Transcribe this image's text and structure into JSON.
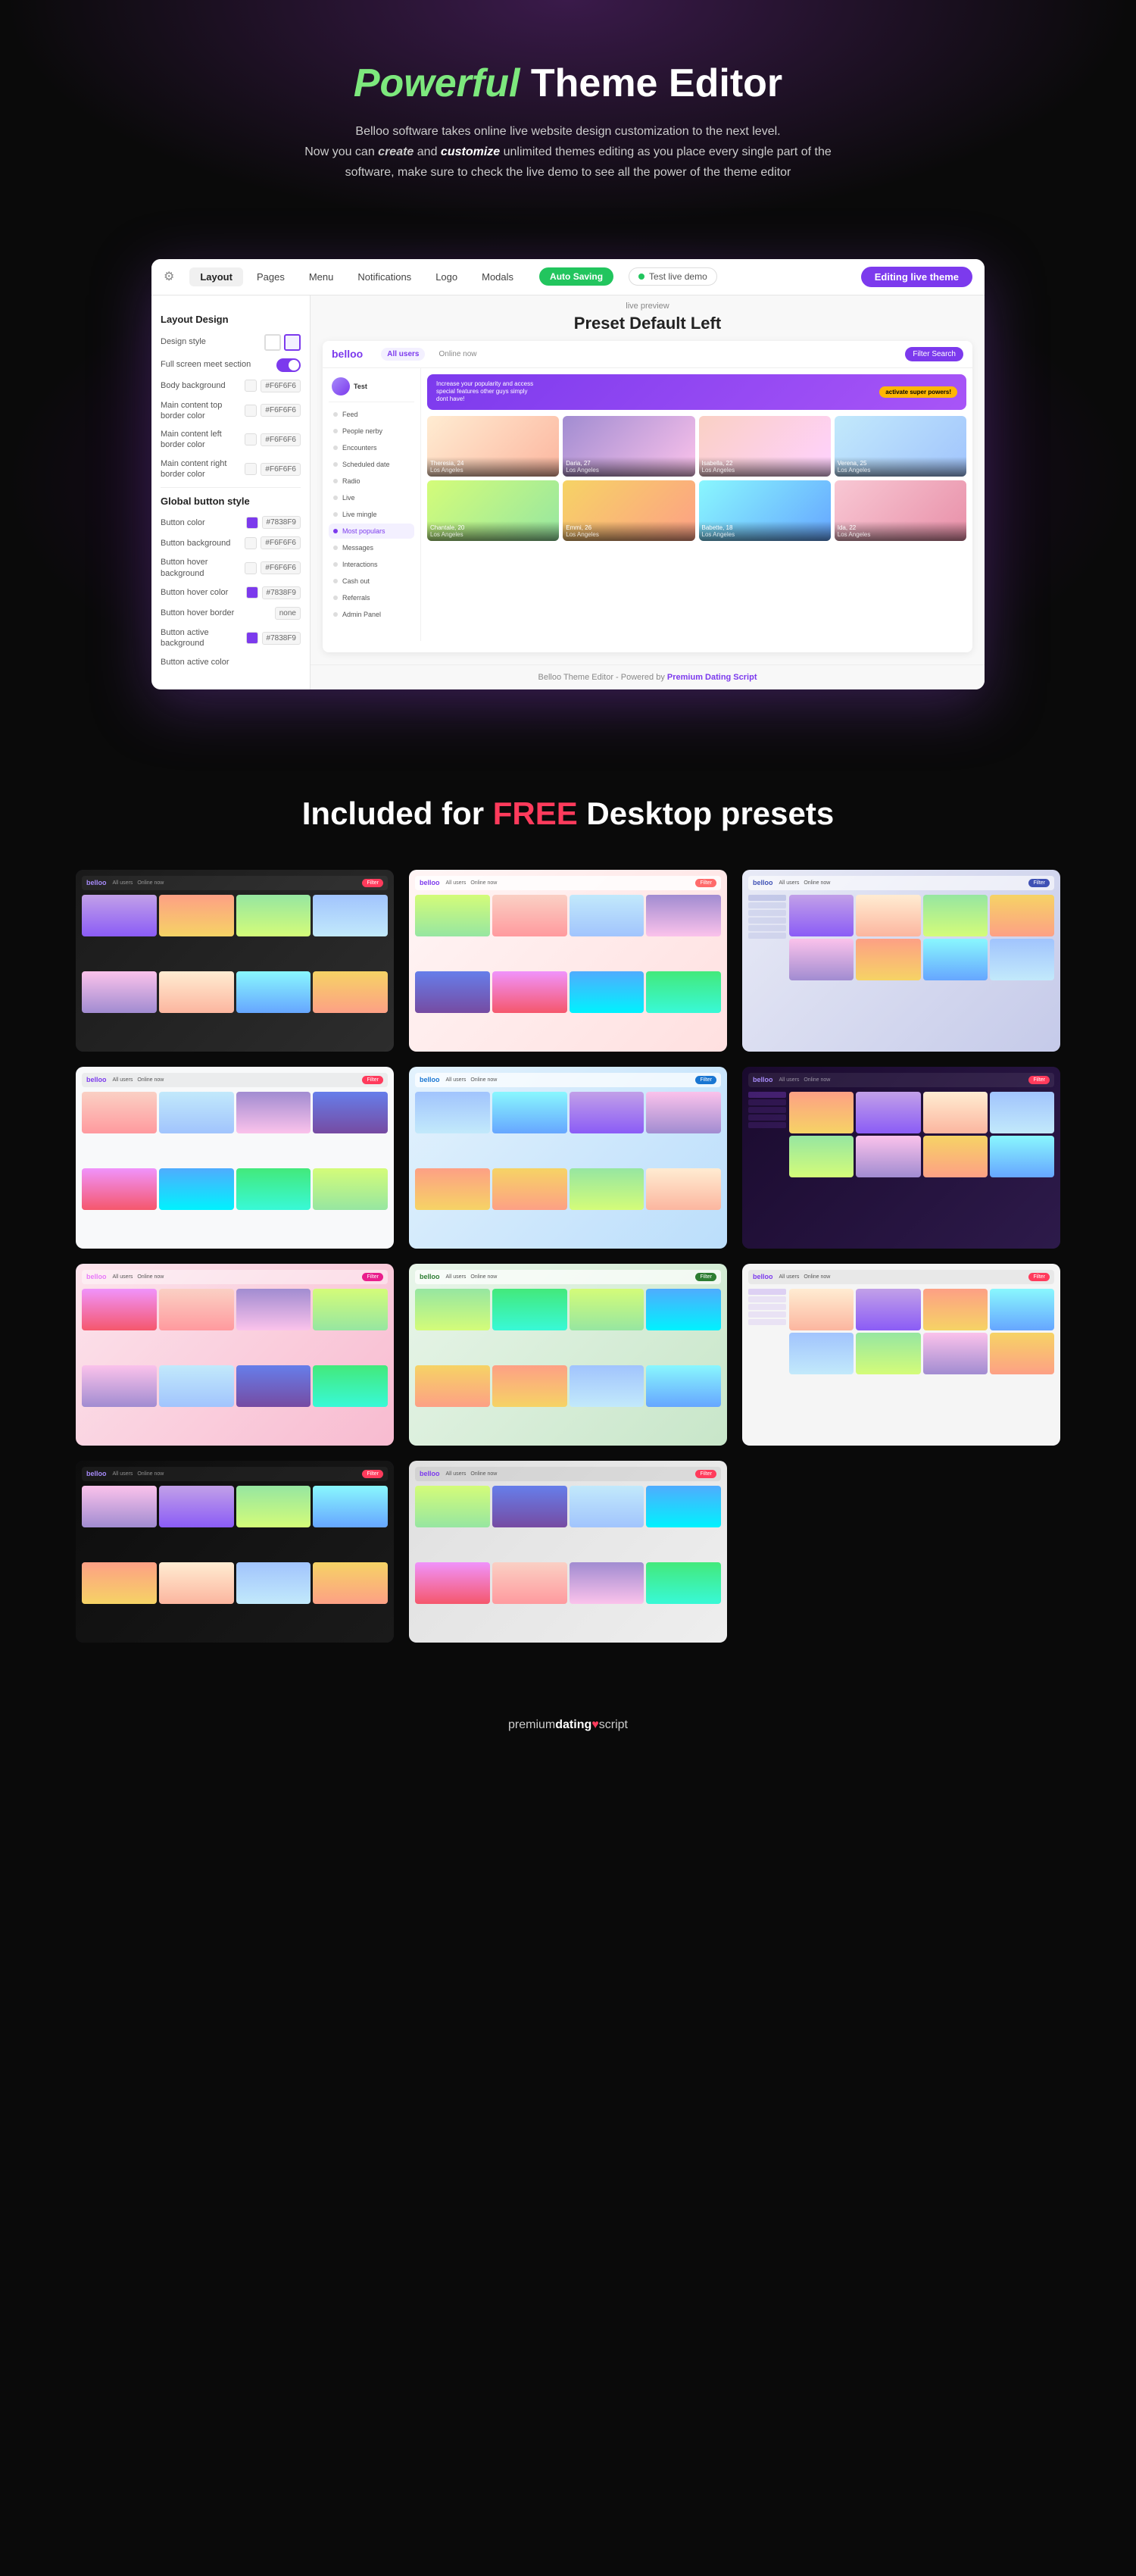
{
  "hero": {
    "title_powerful": "Powerful",
    "title_main": " Theme Editor",
    "subtitle_line1": "Belloo software takes online live website design customization to the next level.",
    "subtitle_line2_pre": "Now you can ",
    "subtitle_line2_create": "create",
    "subtitle_line2_mid": " and ",
    "subtitle_line2_customize": "customize",
    "subtitle_line2_post": " unlimited themes editing as you place every single part of the software, make sure to check the live demo to see all the power of the theme editor"
  },
  "editor": {
    "nav_items": [
      "Layout",
      "Pages",
      "Menu",
      "Notifications",
      "Logo",
      "Modals"
    ],
    "auto_saving_label": "Auto Saving",
    "test_live_label": "Test live demo",
    "editing_live_label": "Editing live theme",
    "preview_label": "live preview",
    "preview_title": "Preset Default Left",
    "left_panel": {
      "layout_design_title": "Layout Design",
      "design_style_label": "Design style",
      "full_section_label": "Full screen meet section",
      "body_bg_label": "Body background",
      "body_bg_value": "#F6F6F6",
      "main_top_label": "Main content top border color",
      "main_top_value": "#F6F6F6",
      "main_left_label": "Main content left border color",
      "main_left_value": "#F6F6F6",
      "main_right_label": "Main content right border color",
      "main_right_value": "#F6F6F6",
      "global_btn_title": "Global button style",
      "btn_color_label": "Button color",
      "btn_color_value": "#7838F9",
      "btn_bg_label": "Button background",
      "btn_bg_value": "#F6F6F6",
      "btn_hover_bg_label": "Button hover background",
      "btn_hover_bg_value": "#F6F6F6",
      "btn_hover_color_label": "Button hover color",
      "btn_hover_color_value": "#7838F9",
      "btn_hover_border_label": "Button hover border",
      "btn_hover_border_value": "none",
      "btn_active_bg_label": "Button active background",
      "btn_active_bg_value": "#7838F9",
      "btn_active_color_label": "Button active color"
    },
    "preview_app": {
      "logo": "belloo",
      "tabs": [
        "All users",
        "Online now"
      ],
      "filter_btn": "Filter Search",
      "sidebar_items": [
        "Feed",
        "People nerby",
        "Encounters",
        "Scheduled date",
        "Radio",
        "Live",
        "Live mingle",
        "Most populars",
        "Messages",
        "Interactions",
        "Cash out",
        "Referrals",
        "Admin Panel"
      ],
      "cards": [
        {
          "name": "Theresia, 24",
          "location": "Los Angeles"
        },
        {
          "name": "Daria, 27",
          "location": "Los Angeles"
        },
        {
          "name": "Isabella, 22",
          "location": "Los Angeles"
        },
        {
          "name": "Verena, 25",
          "location": "Los Angeles"
        },
        {
          "name": "Chantale, 20",
          "location": "Los Angeles"
        },
        {
          "name": "Emmi, 26",
          "location": "Los Angeles"
        },
        {
          "name": "Babette, 18",
          "location": "Los Angeles"
        },
        {
          "name": "Ida, 22",
          "location": "Los Angeles"
        }
      ]
    },
    "footer_text": "Belloo Theme Editor - Powered by ",
    "footer_link": "Premium Dating Script"
  },
  "presets": {
    "title_pre": "Included for ",
    "title_free": "FREE",
    "title_post": " Desktop presets"
  },
  "footer": {
    "premium": "premium",
    "dating": "dating",
    "heart": "♥",
    "script": "script"
  }
}
